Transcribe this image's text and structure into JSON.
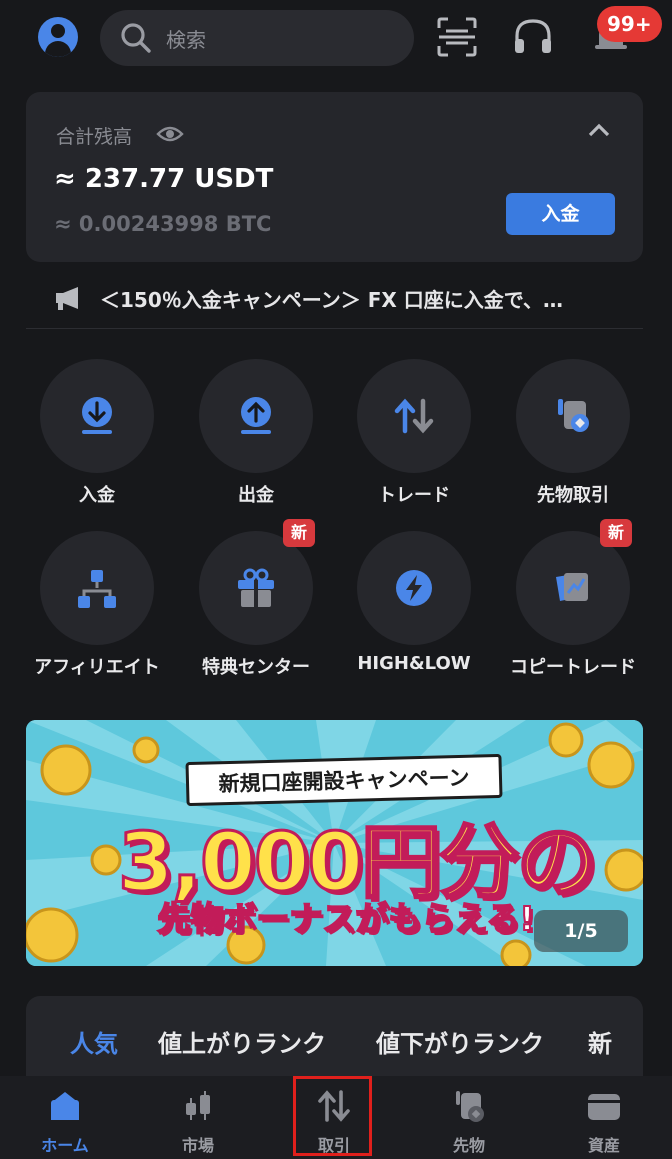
{
  "header": {
    "search_placeholder": "検索",
    "notification_badge": "99+",
    "icons": [
      "avatar-icon",
      "search-icon",
      "scan-icon",
      "headset-icon",
      "bell-icon"
    ]
  },
  "balance": {
    "label": "合計残高",
    "usdt": "≈ 237.77 USDT",
    "btc": "≈ 0.00243998 BTC",
    "deposit_button": "入金"
  },
  "announcement": {
    "text": "＜150％入金キャンペーン＞ FX 口座に入金で、…"
  },
  "quick_actions": [
    {
      "label": "入金",
      "icon": "deposit-icon",
      "is_new": false
    },
    {
      "label": "出金",
      "icon": "withdraw-icon",
      "is_new": false
    },
    {
      "label": "トレード",
      "icon": "trade-icon",
      "is_new": false
    },
    {
      "label": "先物取引",
      "icon": "futures-icon",
      "is_new": false
    },
    {
      "label": "アフィリエイト",
      "icon": "affiliate-icon",
      "is_new": false
    },
    {
      "label": "特典センター",
      "icon": "gift-icon",
      "is_new": true
    },
    {
      "label": "HIGH&LOW",
      "icon": "lightning-icon",
      "is_new": false
    },
    {
      "label": "コピートレード",
      "icon": "copy-trade-icon",
      "is_new": true
    }
  ],
  "new_badge": "新",
  "banner": {
    "ribbon": "新規口座開設キャンペーン",
    "headline": "3,000円分の",
    "subline": "先物ボーナスがもらえる!",
    "pager": "1/5"
  },
  "ranking_tabs": [
    {
      "label": "人気",
      "active": true
    },
    {
      "label": "値上がりランク",
      "active": false
    },
    {
      "label": "値下がりランク",
      "active": false
    },
    {
      "label": "新",
      "active": false
    }
  ],
  "bottom_nav": [
    {
      "label": "ホーム",
      "icon": "home-icon",
      "active": true
    },
    {
      "label": "市場",
      "icon": "market-icon",
      "active": false
    },
    {
      "label": "取引",
      "icon": "trade-icon",
      "active": false
    },
    {
      "label": "先物",
      "icon": "futures-icon",
      "active": false
    },
    {
      "label": "資産",
      "icon": "wallet-icon",
      "active": false
    }
  ],
  "colors": {
    "background": "#17181b",
    "card": "#25262b",
    "accent": "#4a86e8",
    "badge": "#e53935",
    "highlight_box": "#e0201c"
  }
}
